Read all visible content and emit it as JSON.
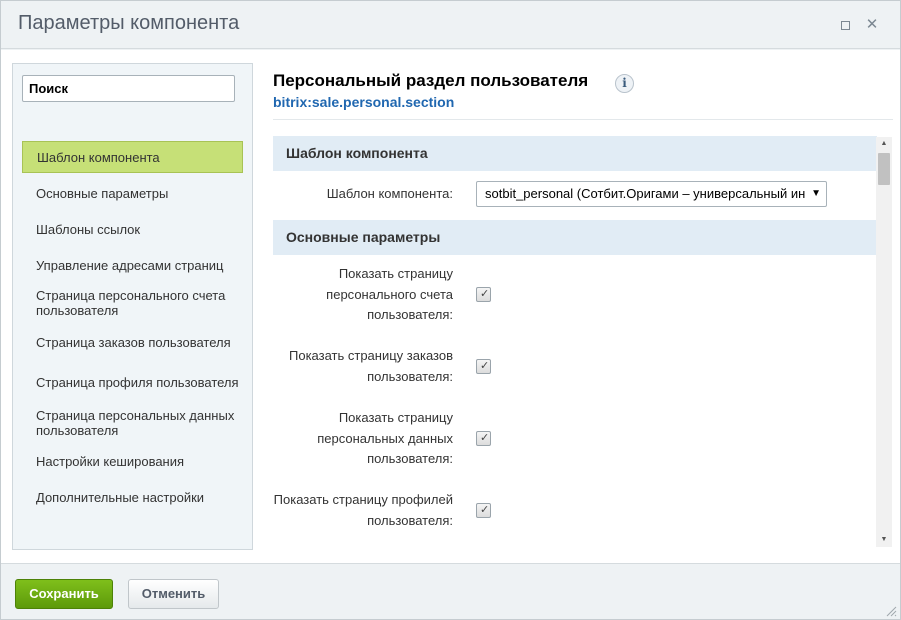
{
  "window": {
    "title": "Параметры компонента"
  },
  "sidebar": {
    "search_placeholder": "Поиск",
    "items": [
      {
        "label": "Шаблон компонента",
        "active": true
      },
      {
        "label": "Основные параметры"
      },
      {
        "label": "Шаблоны ссылок"
      },
      {
        "label": "Управление адресами страниц"
      },
      {
        "label": "Страница персонального счета пользователя"
      },
      {
        "label": "Страница заказов пользователя"
      },
      {
        "label": "Страница профиля пользователя"
      },
      {
        "label": "Страница персональных данных пользователя"
      },
      {
        "label": "Настройки кеширования"
      },
      {
        "label": "Дополнительные настройки"
      }
    ]
  },
  "component": {
    "title": "Персональный раздел пользователя",
    "code": "bitrix:sale.personal.section",
    "info_icon": "i"
  },
  "sections": [
    {
      "title": "Шаблон компонента",
      "fields": [
        {
          "label": "Шаблон компонента:",
          "type": "select",
          "value": "sotbit_personal (Сотбит.Оригами – универсальный ин"
        }
      ]
    },
    {
      "title": "Основные параметры",
      "fields": [
        {
          "label": "Показать страницу персонального счета пользователя:",
          "type": "checkbox",
          "checked": true
        },
        {
          "label": "Показать страницу заказов пользователя:",
          "type": "checkbox",
          "checked": true
        },
        {
          "label": "Показать страницу персональных данных пользователя:",
          "type": "checkbox",
          "checked": true
        },
        {
          "label": "Показать страницу профилей пользователя:",
          "type": "checkbox",
          "checked": true
        }
      ]
    }
  ],
  "footer": {
    "save_label": "Сохранить",
    "cancel_label": "Отменить"
  },
  "colors": {
    "active_nav": "#c6e077",
    "save_button": "#6aa80f",
    "section_header": "#e1ecf5",
    "component_code": "#2067b0"
  }
}
